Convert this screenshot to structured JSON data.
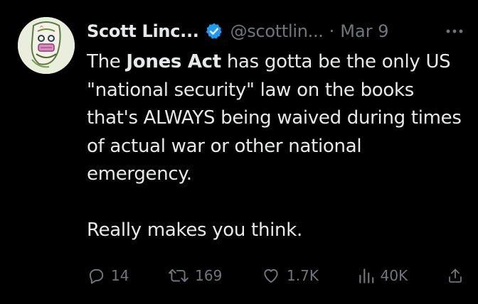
{
  "author": {
    "name": "Scott Linc...",
    "handle": "@scottlin...",
    "separator": "·",
    "date": "Mar 9",
    "verified_color": "#1d9bf0"
  },
  "tweet": {
    "text_line1_pre": "The ",
    "text_bold": "Jones Act",
    "text_line1_post": " has gotta be the only US \"national security\" law on the books that's ALWAYS being waived during times of actual war or other national emergency.",
    "text_line2": "Really makes you think."
  },
  "actions": {
    "replies": "14",
    "reposts": "169",
    "likes": "1.7K",
    "views": "40K"
  },
  "icons": [
    "verified-badge-icon",
    "more-dots-icon",
    "reply-icon",
    "repost-icon",
    "like-icon",
    "views-icon",
    "share-icon"
  ],
  "colors": {
    "background": "#000000",
    "text": "#e7e9ea",
    "secondary": "#71767b",
    "accent": "#1d9bf0"
  }
}
